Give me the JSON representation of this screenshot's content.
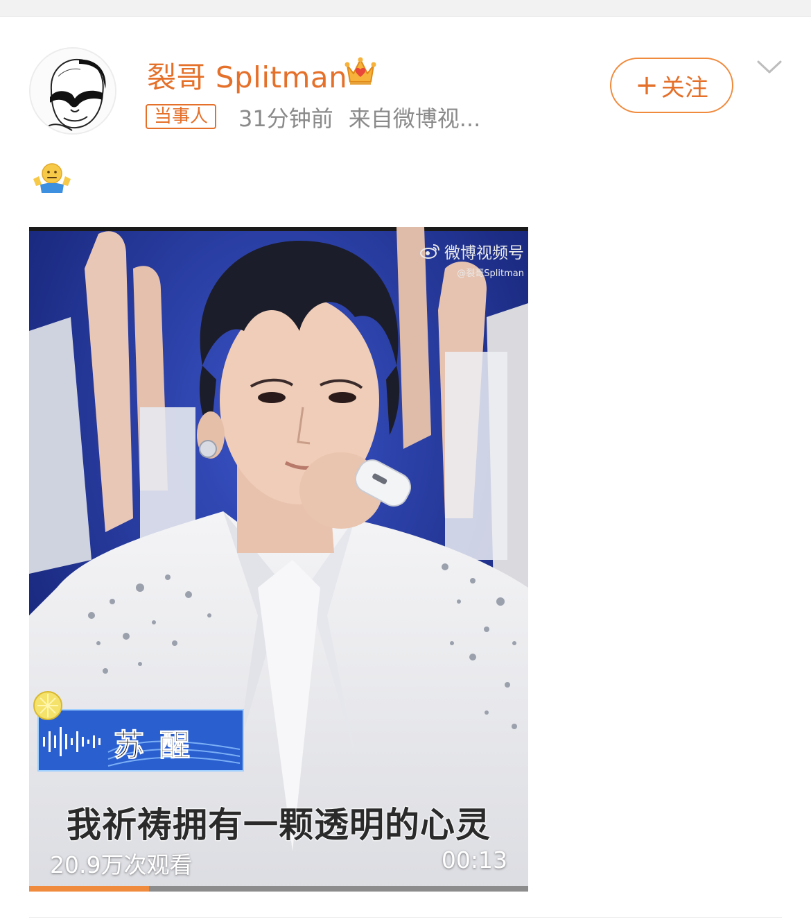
{
  "post": {
    "username": "裂哥 Splitman",
    "badge": "当事人",
    "time": "31分钟前",
    "source": "来自微博视...",
    "follow_label": "关注",
    "follow_plus": "+",
    "content_emoji": "shrug-emoji-icon"
  },
  "video": {
    "watermark_main": "微博视频号",
    "watermark_sub": "@裂哥Splitman",
    "song_title": "苏醒",
    "lyric": "我祈祷拥有一颗透明的心灵",
    "views": "20.9万次观看",
    "duration": "00:13",
    "progress": 0.24
  },
  "colors": {
    "accent": "#e4702a",
    "progress": "#f08a3c",
    "meta_text": "#8a8a8a"
  }
}
